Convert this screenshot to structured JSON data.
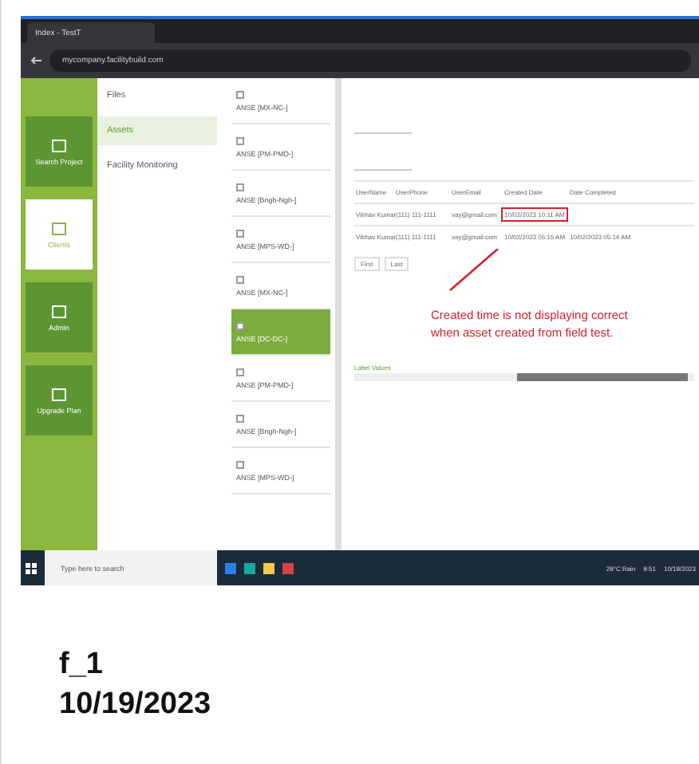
{
  "browser": {
    "tab_title": "Index - TestT",
    "url": "mycompany.facilitybuild.com"
  },
  "rail": [
    {
      "label": "Search Project",
      "selected": false
    },
    {
      "label": "Clients",
      "selected": true
    },
    {
      "label": "Admin",
      "selected": false
    },
    {
      "label": "Upgrade Plan",
      "selected": false
    }
  ],
  "nav": [
    {
      "label": "Files",
      "selected": false
    },
    {
      "label": "Assets",
      "selected": true
    },
    {
      "label": "Facility Monitoring",
      "selected": false
    }
  ],
  "asset_list": [
    {
      "label": "ANSE [MX-NC-]",
      "selected": false
    },
    {
      "label": "ANSE [PM-PMD-]",
      "selected": false
    },
    {
      "label": "ANSE [Bngh-Ngh-]",
      "selected": false
    },
    {
      "label": "ANSE [MPS-WD-]",
      "selected": false
    },
    {
      "label": "ANSE [MX-NC-]",
      "selected": false
    },
    {
      "label": "ANSE [DC-DC-]",
      "selected": true
    },
    {
      "label": "ANSE [PM-PMD-]",
      "selected": false
    },
    {
      "label": "ANSE [Bngh-Ngh-]",
      "selected": false
    },
    {
      "label": "ANSE [MPS-WD-]",
      "selected": false
    }
  ],
  "table": {
    "columns": [
      "UserName",
      "UserPhone",
      "UserEmail",
      "Created Date",
      "Date Completed"
    ],
    "rows": [
      {
        "cells": [
          "Vibhav Kumar",
          "(111) 111-1111",
          "vay@gmail.com",
          "10/02/2023 10:11 AM",
          ""
        ],
        "created_date_flagged": true
      },
      {
        "cells": [
          "Vibhav Kumar",
          "(111) 111-1111",
          "vay@gmail.com",
          "10/02/2023 05:15 AM",
          "10/02/2023 05:14 AM"
        ],
        "created_date_flagged": false
      }
    ]
  },
  "pager": [
    "First",
    "Last"
  ],
  "annotation": "Created time is not displaying correct when asset created from field test.",
  "scroll_label": "Label Values",
  "taskbar": {
    "search_placeholder": "Type here to search",
    "weather": "29°C Rain",
    "time": "9:51",
    "date": "10/19/2023"
  },
  "caption": {
    "title": "f_1",
    "date": "10/19/2023"
  }
}
